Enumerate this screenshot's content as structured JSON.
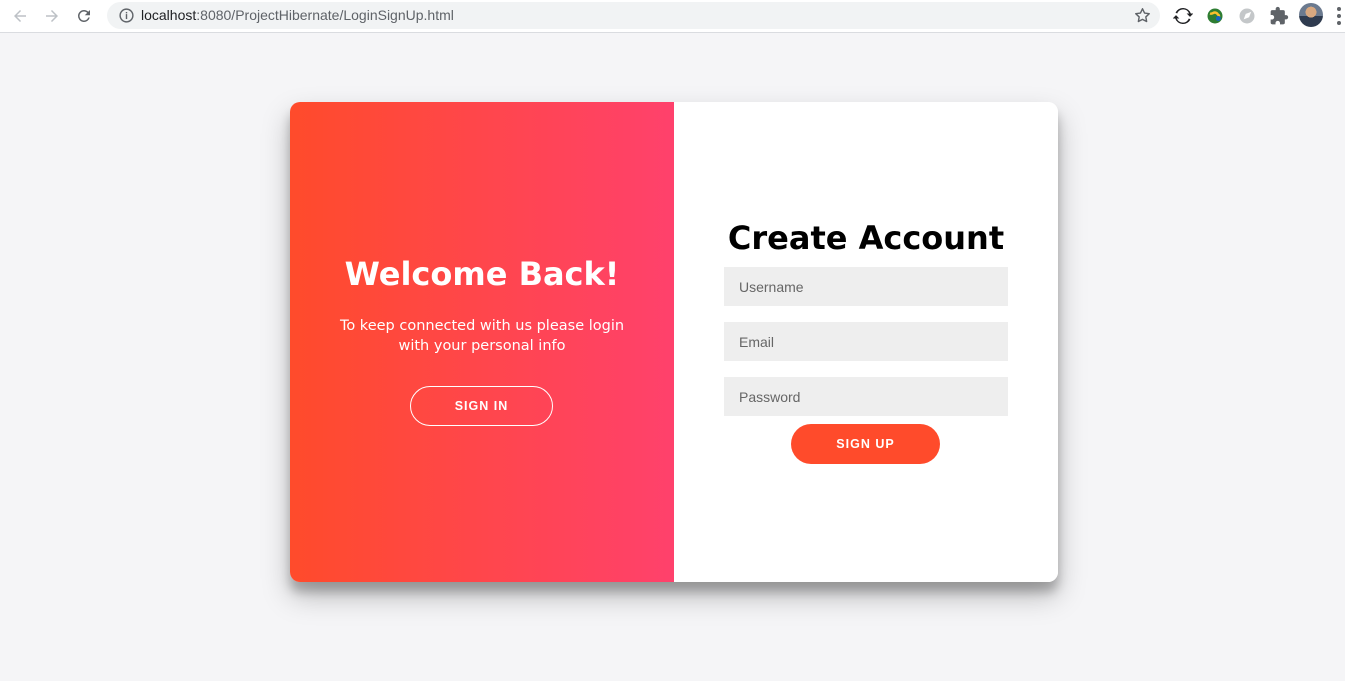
{
  "browser": {
    "url_host": "localhost",
    "url_rest": ":8080/ProjectHibernate/LoginSignUp.html",
    "icons": {
      "back": "back-arrow-icon",
      "forward": "forward-arrow-icon",
      "reload": "reload-icon",
      "info": "info-icon",
      "bookmark": "star-icon",
      "extensions": [
        "sync-extension-icon",
        "globe-extension-icon",
        "compass-extension-icon",
        "puzzle-extension-icon"
      ],
      "menu": "kebab-menu-icon"
    }
  },
  "overlay": {
    "title": "Welcome Back!",
    "text": "To keep connected with us please login with your personal info",
    "button_label": "SIGN IN"
  },
  "signup": {
    "title": "Create Account",
    "username_placeholder": "Username",
    "email_placeholder": "Email",
    "password_placeholder": "Password",
    "button_label": "SIGN UP"
  },
  "colors": {
    "gradient_start": "#ff4b2b",
    "gradient_end": "#ff416c",
    "page_background": "#f5f5f7",
    "input_background": "#eeeeee"
  }
}
